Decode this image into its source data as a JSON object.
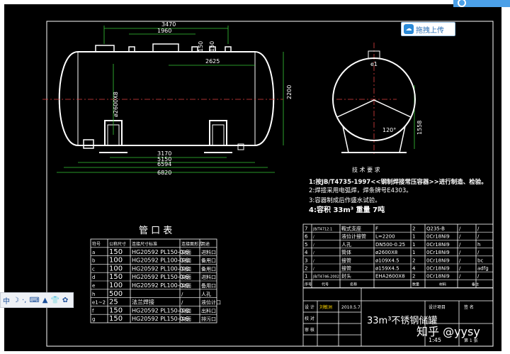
{
  "upload_button": {
    "label": "拖拽上传"
  },
  "watermark": {
    "text": "知乎 @yysy"
  },
  "ime_toolbar": {
    "lang": "中",
    "moon": "☽",
    "punct": "·,",
    "kbd": "⌨",
    "tool1": "▲",
    "tool2": "👕",
    "gear": "✿"
  },
  "dims": {
    "d3470": "3470",
    "d1960": "1960",
    "d150a": "150",
    "d150b": "150",
    "d2625": "2625",
    "d2200": "2200",
    "d3170": "3170",
    "d5150": "5150",
    "d6594": "6594",
    "d6820": "6820",
    "dDN": "ø2600X8",
    "d1558": "1558",
    "angle": "120°",
    "e1": "e1"
  },
  "tech": {
    "title": "技 术 要 求",
    "l1": "1:按JB/T4735-1997<<钢制焊接常压容器>>进行制造、检验。",
    "l2": "2:焊接采用电弧焊，焊条牌号E4303。",
    "l3": "3:容器制成后作盛水试验。",
    "l4": "4:容积 33m³ 重量 7吨"
  },
  "nozzle_table": {
    "title": "管 口 表",
    "headers": [
      "符号",
      "公称尺寸",
      "连接尺寸标准",
      "连接面形式",
      "用途"
    ],
    "rows": [
      [
        "a",
        "150",
        "HG20592 PL150-0.6",
        "突面",
        "进料口"
      ],
      [
        "b",
        "100",
        "HG20592 PL100-0.6",
        "突面",
        "备用口"
      ],
      [
        "c",
        "100",
        "HG20592 PL100-0.6",
        "突面",
        "备用口"
      ],
      [
        "d",
        "150",
        "HG20592 PL150-0.6",
        "突面",
        "进料口"
      ],
      [
        "e",
        "100",
        "HG20592 PL100-0.6",
        "突面",
        "备用口"
      ],
      [
        "h",
        "500",
        "",
        "/",
        "人孔"
      ],
      [
        "e1~2",
        "25",
        "法兰焊接",
        "/",
        "液位计口"
      ],
      [
        "f",
        "150",
        "HG20592 PL150-0.6",
        "突面",
        "出料口"
      ],
      [
        "g",
        "150",
        "HG20592 PL150-0.6",
        "突面",
        "排污口"
      ]
    ]
  },
  "parts_table": {
    "rows": [
      [
        "7",
        "JB/T4712.1",
        "鞍式支座",
        "F",
        "2",
        "Q235-B",
        "/",
        "/"
      ],
      [
        "6",
        "/",
        "液位计接管",
        "L=2200",
        "1",
        "0Cr18Ni9",
        "/",
        "/"
      ],
      [
        "5",
        "/",
        "人孔",
        "DN500-0.25",
        "1",
        "0Cr18Ni9",
        "/",
        "h"
      ],
      [
        "4",
        "/",
        "筒体",
        "ø2600X8",
        "1",
        "0Cr18Ni9",
        "/",
        "/"
      ],
      [
        "3",
        "/",
        "接管",
        "ø109X4.5",
        "2",
        "0Cr18Ni9",
        "/",
        "bc"
      ],
      [
        "2",
        "/",
        "接管",
        "ø159X4.5",
        "4",
        "0Cr18Ni9",
        "/",
        "adfg"
      ],
      [
        "1",
        "JB/T4746-2002",
        "封头",
        "EHA2600X8",
        "2",
        "0Cr18Ni9",
        "/",
        "/"
      ]
    ],
    "header_row": [
      "序号",
      "代号",
      "名称",
      "数量",
      "材料",
      "备注"
    ]
  },
  "title_block": {
    "designer": "设 计",
    "designer_name": "刘敏洲",
    "date": "2010.5.7",
    "check": "校 对",
    "approve": "审 核",
    "drawing_title": "33m³不锈钢储罐",
    "project": "设计项目",
    "sheet": "第 1 张",
    "scale": "1:45",
    "total": "共 1 张",
    "sign": "签 名"
  }
}
